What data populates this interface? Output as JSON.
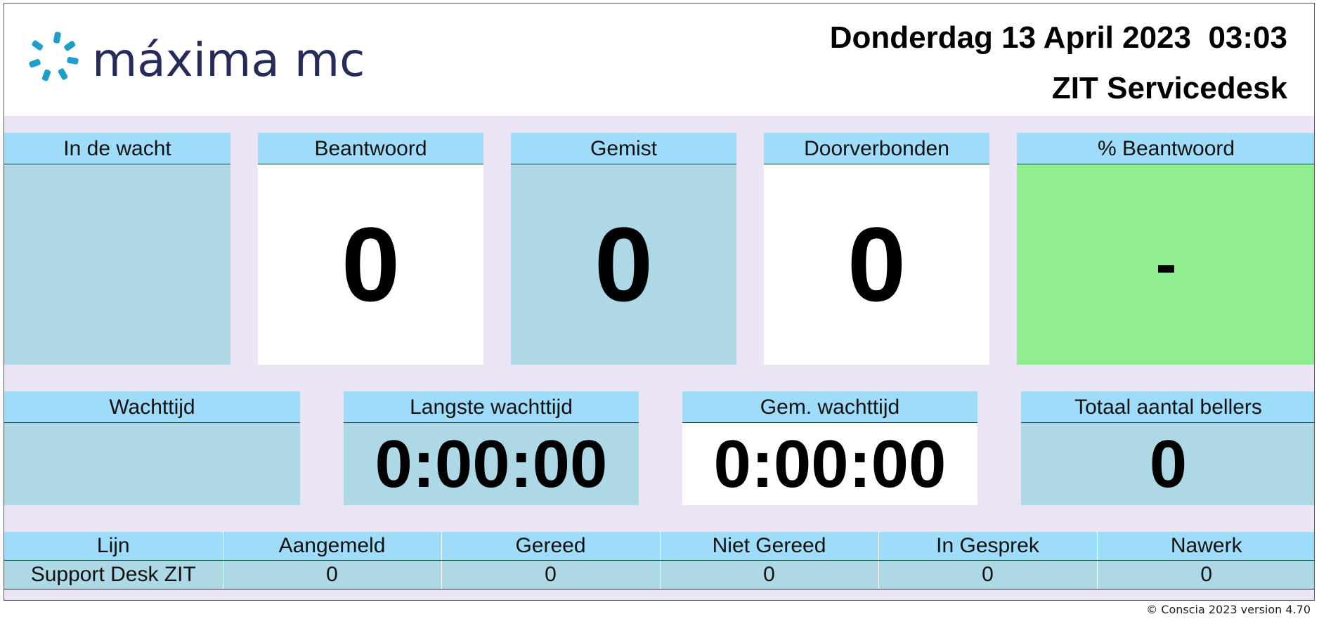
{
  "header": {
    "logo_text": "máxima mc",
    "datetime": "Donderdag 13 April 2023  03:03",
    "department": "ZIT Servicedesk"
  },
  "stats": {
    "in_de_wacht": {
      "label": "In de wacht",
      "value": ""
    },
    "beantwoord": {
      "label": "Beantwoord",
      "value": "0"
    },
    "gemist": {
      "label": "Gemist",
      "value": "0"
    },
    "doorverbonden": {
      "label": "Doorverbonden",
      "value": "0"
    },
    "pct_beantwoord": {
      "label": "% Beantwoord",
      "value": "-"
    }
  },
  "times": {
    "wachttijd": {
      "label": "Wachttijd",
      "value": ""
    },
    "langste": {
      "label": "Langste wachttijd",
      "value": "0:00:00"
    },
    "gemiddeld": {
      "label": "Gem. wachttijd",
      "value": "0:00:00"
    },
    "totaal": {
      "label": "Totaal aantal bellers",
      "value": "0"
    }
  },
  "lines_table": {
    "headers": [
      "Lijn",
      "Aangemeld",
      "Gereed",
      "Niet Gereed",
      "In Gesprek",
      "Nawerk"
    ],
    "rows": [
      [
        "Support Desk ZIT",
        "0",
        "0",
        "0",
        "0",
        "0"
      ]
    ]
  },
  "footer": "© Conscia 2023 version 4.70",
  "colors": {
    "header_blue": "#9edcfa",
    "tile_blue": "#add8e6",
    "tile_green": "#90ee90",
    "background": "#ebe4f4",
    "logo_navy": "#262b59",
    "logo_teal": "#1e9ec9"
  },
  "icons": {
    "logo": "maxima-logo-icon"
  }
}
